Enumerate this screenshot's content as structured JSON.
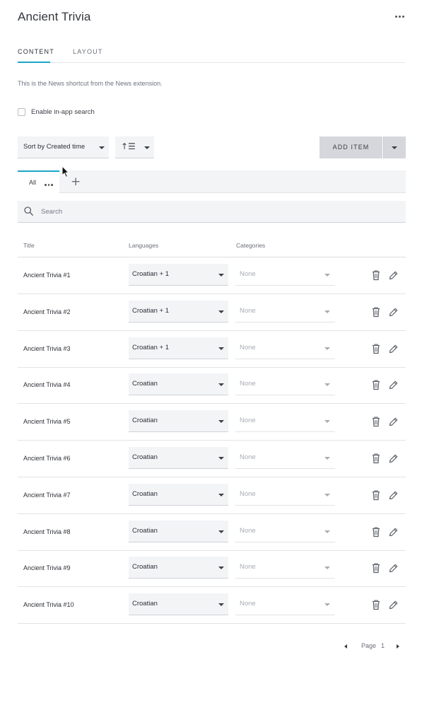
{
  "page": {
    "title": "Ancient Trivia"
  },
  "tabs": [
    {
      "label": "CONTENT",
      "active": true
    },
    {
      "label": "LAYOUT",
      "active": false
    }
  ],
  "description": "This is the News shortcut from the News extension.",
  "search_toggle": {
    "label": "Enable in-app search",
    "checked": false
  },
  "sort": {
    "value": "Sort by Created time"
  },
  "order": {
    "icon": "sort-order-icon"
  },
  "add_item": {
    "label": "ADD ITEM"
  },
  "filters": {
    "tabs": [
      {
        "label": "All",
        "active": true
      }
    ]
  },
  "search": {
    "placeholder": "Search",
    "value": ""
  },
  "table": {
    "columns": [
      "Title",
      "Languages",
      "Categories"
    ],
    "rows": [
      {
        "title": "Ancient Trivia #1",
        "languages": "Croatian + 1",
        "categories": "None"
      },
      {
        "title": "Ancient Trivia #2",
        "languages": "Croatian + 1",
        "categories": "None"
      },
      {
        "title": "Ancient Trivia #3",
        "languages": "Croatian + 1",
        "categories": "None"
      },
      {
        "title": "Ancient Trivia #4",
        "languages": "Croatian",
        "categories": "None"
      },
      {
        "title": "Ancient Trivia #5",
        "languages": "Croatian",
        "categories": "None"
      },
      {
        "title": "Ancient Trivia #6",
        "languages": "Croatian",
        "categories": "None"
      },
      {
        "title": "Ancient Trivia #7",
        "languages": "Croatian",
        "categories": "None"
      },
      {
        "title": "Ancient Trivia #8",
        "languages": "Croatian",
        "categories": "None"
      },
      {
        "title": "Ancient Trivia #9",
        "languages": "Croatian",
        "categories": "None"
      },
      {
        "title": "Ancient Trivia #10",
        "languages": "Croatian",
        "categories": "None"
      }
    ]
  },
  "pagination": {
    "label": "Page",
    "current": "1"
  },
  "colors": {
    "accent": "#1ba6c9",
    "field_bg": "#f3f4f6",
    "button_bg": "#d5d7dc"
  }
}
